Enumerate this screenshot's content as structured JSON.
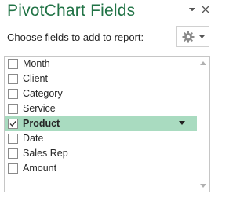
{
  "header": {
    "title": "PivotChart Fields",
    "options_icon": "chevron-down-icon",
    "close_icon": "close-icon"
  },
  "subtitle": "Choose fields to add to report:",
  "tools_button": {
    "icon": "gear-icon",
    "dropdown_icon": "chevron-down-icon"
  },
  "fields": [
    {
      "label": "Month",
      "checked": false,
      "selected": false
    },
    {
      "label": "Client",
      "checked": false,
      "selected": false
    },
    {
      "label": "Category",
      "checked": false,
      "selected": false
    },
    {
      "label": "Service",
      "checked": false,
      "selected": false
    },
    {
      "label": "Product",
      "checked": true,
      "selected": true
    },
    {
      "label": "Date",
      "checked": false,
      "selected": false
    },
    {
      "label": "Sales Rep",
      "checked": false,
      "selected": false
    },
    {
      "label": "Amount",
      "checked": false,
      "selected": false
    }
  ],
  "colors": {
    "title": "#217346",
    "selected_row": "#a9dbc0",
    "border": "#c6c6c6"
  }
}
